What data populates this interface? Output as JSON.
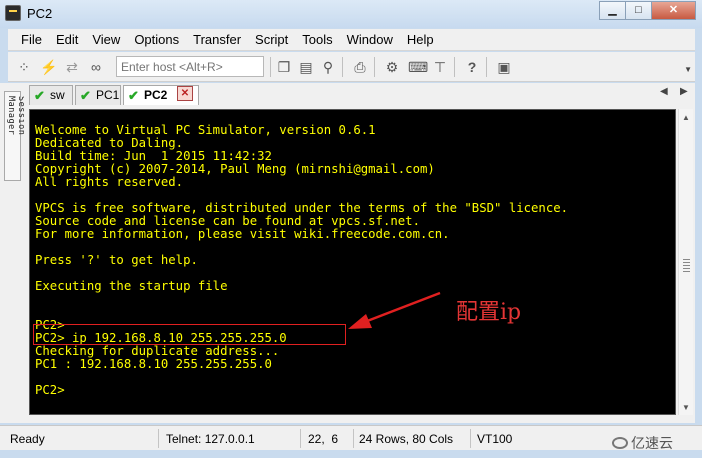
{
  "window": {
    "title": "PC2"
  },
  "window_buttons": {
    "minimize": "▁",
    "maximize": "□",
    "close": "✕"
  },
  "menu": [
    "File",
    "Edit",
    "View",
    "Options",
    "Transfer",
    "Script",
    "Tools",
    "Window",
    "Help"
  ],
  "toolbar": {
    "host_placeholder": "Enter host <Alt+R>",
    "icons": [
      "connect-icon",
      "lightning-icon",
      "reconnect-icon",
      "link-icon",
      "copy-icon",
      "paste-icon",
      "find-icon",
      "print-icon",
      "settings-icon",
      "keymap-icon",
      "sftp-icon",
      "help-icon",
      "screen-icon"
    ]
  },
  "session_manager": {
    "label": "Session Manager"
  },
  "tabs": [
    {
      "label": "sw",
      "status": "connected",
      "active": false
    },
    {
      "label": "PC1",
      "status": "connected",
      "active": false
    },
    {
      "label": "PC2",
      "status": "connected",
      "active": true
    }
  ],
  "terminal": {
    "lines": [
      "Welcome to Virtual PC Simulator, version 0.6.1",
      "Dedicated to Daling.",
      "Build time: Jun  1 2015 11:42:32",
      "Copyright (c) 2007-2014, Paul Meng (mirnshi@gmail.com)",
      "All rights reserved.",
      "",
      "VPCS is free software, distributed under the terms of the \"BSD\" licence.",
      "Source code and license can be found at vpcs.sf.net.",
      "For more information, please visit wiki.freecode.com.cn.",
      "",
      "Press '?' to get help.",
      "",
      "Executing the startup file",
      "",
      "",
      "PC2>",
      "PC2> ip 192.168.8.10 255.255.255.0",
      "Checking for duplicate address...",
      "PC1 : 192.168.8.10 255.255.255.0",
      "",
      "PC2>"
    ]
  },
  "annotation": {
    "text": "配置ip",
    "color": "#e43535"
  },
  "status": {
    "state": "Ready",
    "connection": "Telnet: 127.0.0.1",
    "cursor": "22,  6",
    "size": "24 Rows, 80 Cols",
    "emulation": "VT100"
  },
  "watermark": {
    "text": "亿速云"
  },
  "colors": {
    "terminal_bg": "#000000",
    "terminal_fg": "#ffff00",
    "tab_check": "#27a827"
  }
}
